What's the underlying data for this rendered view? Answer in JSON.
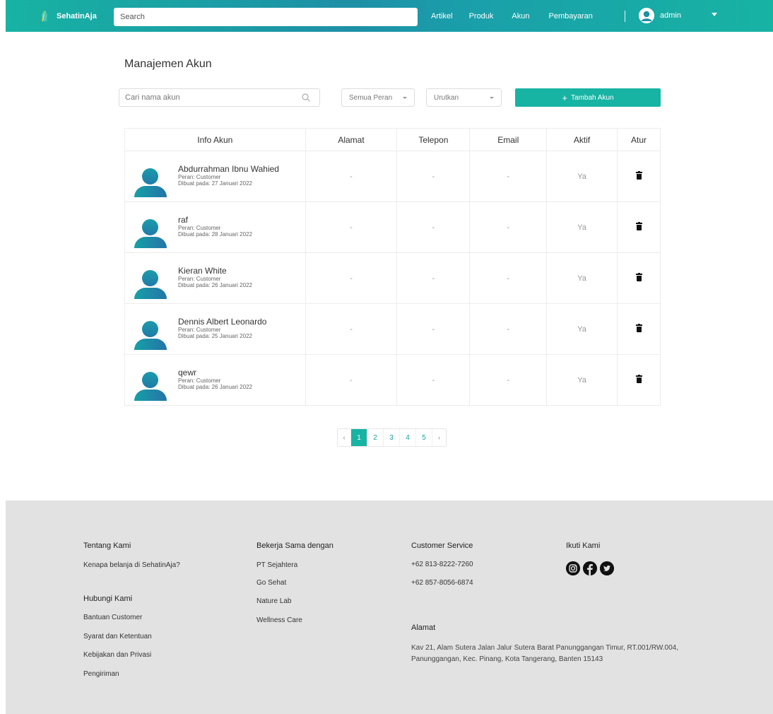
{
  "navbar": {
    "brand": "SehatinAja",
    "search_placeholder": "Search",
    "links": [
      "Artikel",
      "Produk",
      "Akun",
      "Pembayaran"
    ],
    "user": "admin"
  },
  "page": {
    "title": "Manajemen Akun",
    "search_placeholder": "Cari nama akun",
    "role_filter": "Semua Peran",
    "sort_filter": "Urutkan",
    "add_button": "Tambah Akun",
    "add_plus": "+"
  },
  "table": {
    "headers": [
      "Info Akun",
      "Alamat",
      "Telepon",
      "Email",
      "Aktif",
      "Atur"
    ],
    "rows": [
      {
        "name": "Abdurrahman Ibnu Wahied",
        "role": "Peran: Customer",
        "created": "Dibuat pada: 27 Januari 2022",
        "alamat": "-",
        "telepon": "-",
        "email": "-",
        "aktif": "Ya"
      },
      {
        "name": "raf",
        "role": "Peran: Customer",
        "created": "Dibuat pada: 28 Januari 2022",
        "alamat": "-",
        "telepon": "-",
        "email": "-",
        "aktif": "Ya"
      },
      {
        "name": "Kieran White",
        "role": "Peran: Customer",
        "created": "Dibuat pada: 26 Januari 2022",
        "alamat": "-",
        "telepon": "-",
        "email": "-",
        "aktif": "Ya"
      },
      {
        "name": "Dennis Albert Leonardo",
        "role": "Peran: Customer",
        "created": "Dibuat pada: 25 Januari 2022",
        "alamat": "-",
        "telepon": "-",
        "email": "-",
        "aktif": "Ya"
      },
      {
        "name": "qewr",
        "role": "Peran: Customer",
        "created": "Dibuat pada: 26 Januari 2022",
        "alamat": "-",
        "telepon": "-",
        "email": "-",
        "aktif": "Ya"
      }
    ]
  },
  "pagination": {
    "prev": "‹",
    "next": "›",
    "pages": [
      "1",
      "2",
      "3",
      "4",
      "5"
    ],
    "current": "1"
  },
  "footer": {
    "about_title": "Tentang Kami",
    "about_link": "Kenapa belanja di SehatinAja?",
    "contact_title": "Hubungi Kami",
    "contact_links": [
      "Bantuan Customer",
      "Syarat dan Ketentuan",
      "Kebijakan dan Privasi",
      "Pengiriman"
    ],
    "partners_title": "Bekerja Sama dengan",
    "partners": [
      "PT Sejahtera",
      "Go Sehat",
      "Nature Lab",
      "Wellness Care"
    ],
    "cs_title": "Customer Service",
    "cs_phones": [
      "+62 813-8222-7260",
      "+62 857-8056-6874"
    ],
    "address_title": "Alamat",
    "address": "Kav 21, Alam Sutera Jalan Jalur Sutera Barat Panunggangan Timur, RT.001/RW.004, Panunggangan, Kec. Pinang, Kota Tangerang, Banten 15143",
    "follow_title": "Ikuti Kami",
    "social_icons": [
      "instagram-icon",
      "facebook-icon",
      "twitter-icon"
    ]
  },
  "colors": {
    "accent": "#17b3a3",
    "nav_gradient_mid": "#1e8fa6",
    "footer_bg": "#e2e2e2"
  }
}
